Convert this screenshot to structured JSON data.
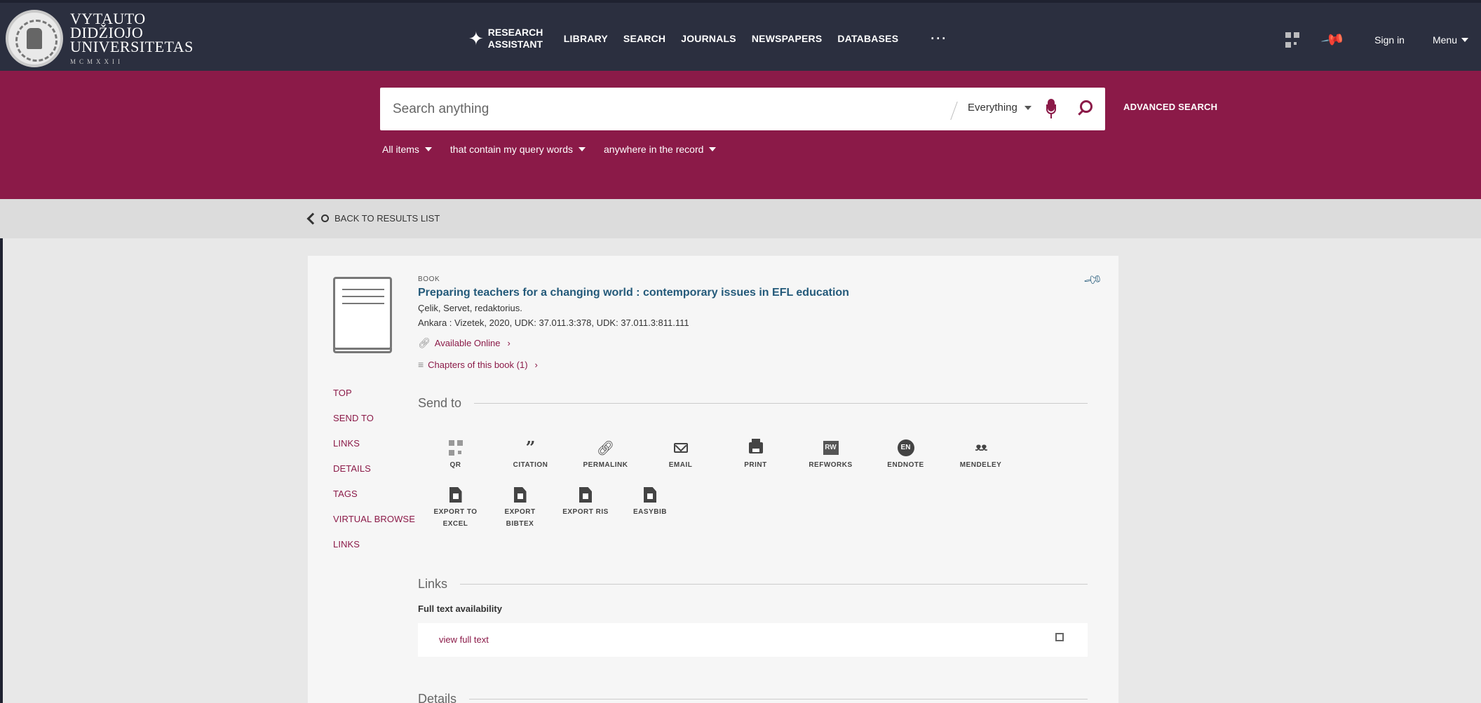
{
  "logo": {
    "line1": "VYTAUTO",
    "line2": "DIDŽIOJO",
    "line3": "UNIVERSITETAS",
    "roman": "MCMXXII"
  },
  "nav": {
    "research_line1": "RESEARCH",
    "research_line2": "ASSISTANT",
    "links": [
      "LIBRARY",
      "SEARCH",
      "JOURNALS",
      "NEWSPAPERS",
      "DATABASES"
    ],
    "more": "···",
    "sign_in": "Sign in",
    "menu": "Menu"
  },
  "search": {
    "placeholder": "Search anything",
    "scope": "Everything",
    "advanced": "ADVANCED SEARCH",
    "filters": [
      "All items",
      "that contain my query words",
      "anywhere in the record"
    ]
  },
  "back": {
    "label": "BACK TO RESULTS LIST"
  },
  "record": {
    "type": "BOOK",
    "title": "Preparing teachers for a changing world : contemporary issues in EFL education",
    "author": "Çelik, Servet, redaktorius.",
    "publication": "Ankara : Vizetek, 2020, UDK: 37.011.3:378, UDK: 37.011.3:811.111",
    "available": "Available Online",
    "chapters": "Chapters of this book (1)"
  },
  "sidenav": [
    "TOP",
    "SEND TO",
    "LINKS",
    "DETAILS",
    "TAGS",
    "VIRTUAL BROWSE",
    "LINKS"
  ],
  "send_to": {
    "heading": "Send to",
    "actions": [
      {
        "label": "QR",
        "icon": "qr-icon"
      },
      {
        "label": "CITATION",
        "icon": "quote-icon"
      },
      {
        "label": "PERMALINK",
        "icon": "link-icon"
      },
      {
        "label": "EMAIL",
        "icon": "mail-icon"
      },
      {
        "label": "PRINT",
        "icon": "print-icon"
      },
      {
        "label": "REFWORKS",
        "icon": "refworks-icon",
        "badge": "RW"
      },
      {
        "label": "ENDNOTE",
        "icon": "endnote-icon",
        "badge": "EN"
      },
      {
        "label": "MENDELEY",
        "icon": "mendeley-icon"
      },
      {
        "label": "EXPORT TO EXCEL",
        "icon": "excel-file-icon"
      },
      {
        "label": "EXPORT BIBTEX",
        "icon": "bibtex-file-icon"
      },
      {
        "label": "EXPORT RIS",
        "icon": "ris-file-icon"
      },
      {
        "label": "EASYBIB",
        "icon": "easybib-file-icon"
      }
    ]
  },
  "links": {
    "heading": "Links",
    "fulltext_label": "Full text availability",
    "view_full_text": "view full text"
  },
  "details": {
    "heading": "Details"
  },
  "colors": {
    "topbar": "#2b2f3f",
    "brand": "#8b1a48",
    "title_link": "#245a7a"
  }
}
